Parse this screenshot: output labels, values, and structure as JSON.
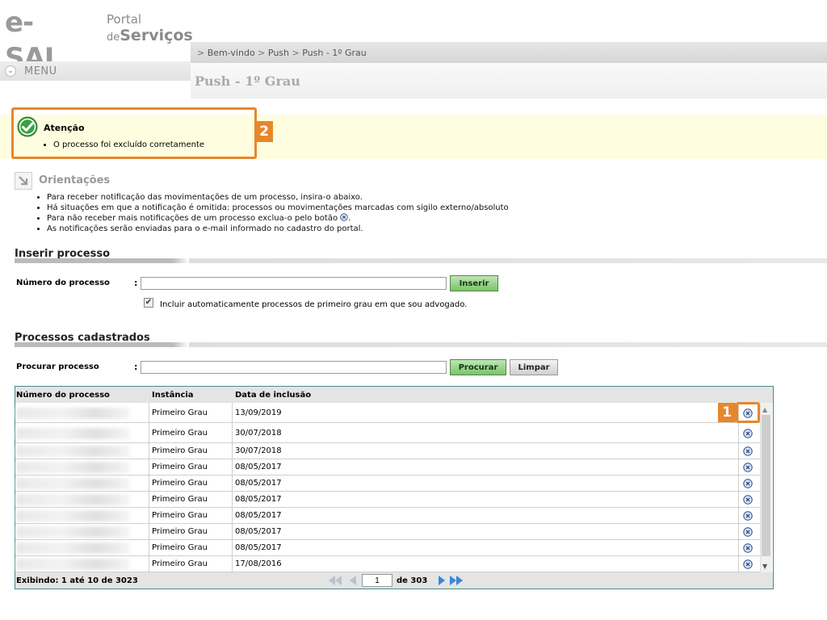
{
  "header": {
    "logo_esaj": "e-SAJ",
    "logo_portal": "Portal",
    "logo_de": "de",
    "logo_servicos": "Serviços",
    "menu_label": "MENU",
    "page_title": "Push - 1º Grau"
  },
  "breadcrumb": {
    "sep": ">",
    "items": [
      "Bem-vindo",
      "Push",
      "Push - 1º Grau"
    ]
  },
  "message": {
    "title": "Atenção",
    "items": [
      "O processo foi excluído corretamente"
    ],
    "callout_number": "2"
  },
  "orientacoes": {
    "title": "Orientações",
    "items": [
      "Para receber notificação das movimentações de um processo, insira-o abaixo.",
      "Há situações em que a notificação é omitida: processos ou movimentações marcadas com sigilo externo/absoluto",
      "Para não receber mais notificações de um processo exclua-o pelo botão",
      "As notificações serão enviadas para o e-mail informado no cadastro do portal."
    ],
    "item3_suffix": "."
  },
  "inserir": {
    "section_title": "Inserir processo",
    "field_label": "Número do processo",
    "colon": ":",
    "input_value": "",
    "button_label": "Inserir",
    "checkbox_checked": true,
    "checkbox_label": "Incluir automaticamente processos de primeiro grau em que sou advogado."
  },
  "cadastrados": {
    "section_title": "Processos cadastrados",
    "search_label": "Procurar processo",
    "colon": ":",
    "search_value": "",
    "search_button": "Procurar",
    "clear_button": "Limpar"
  },
  "table": {
    "headers": [
      "Número do processo",
      "Instância",
      "Data de inclusão"
    ],
    "rows": [
      {
        "instancia": "Primeiro Grau",
        "data": "13/09/2019"
      },
      {
        "instancia": "Primeiro Grau",
        "data": "30/07/2018"
      },
      {
        "instancia": "Primeiro Grau",
        "data": "30/07/2018"
      },
      {
        "instancia": "Primeiro Grau",
        "data": "08/05/2017"
      },
      {
        "instancia": "Primeiro Grau",
        "data": "08/05/2017"
      },
      {
        "instancia": "Primeiro Grau",
        "data": "08/05/2017"
      },
      {
        "instancia": "Primeiro Grau",
        "data": "08/05/2017"
      },
      {
        "instancia": "Primeiro Grau",
        "data": "08/05/2017"
      },
      {
        "instancia": "Primeiro Grau",
        "data": "08/05/2017"
      },
      {
        "instancia": "Primeiro Grau",
        "data": "17/08/2016"
      }
    ],
    "callout_number": "1",
    "showing": "Exibindo: 1 até 10 de 3023",
    "current_page": "1",
    "page_of": "de 303"
  },
  "icons": {
    "check": "check-circle-icon",
    "delete": "delete-x-icon",
    "orient": "arrow-down-right-icon",
    "menu": "chevron-down-icon",
    "first": "first-page-icon",
    "prev": "prev-page-icon",
    "next": "next-page-icon",
    "last": "last-page-icon"
  },
  "colors": {
    "accent_orange": "#e8862a",
    "success_green": "#3aa142",
    "button_green": "#7cc26b",
    "message_bg": "#fffde0",
    "table_border": "#4a8a8a"
  }
}
